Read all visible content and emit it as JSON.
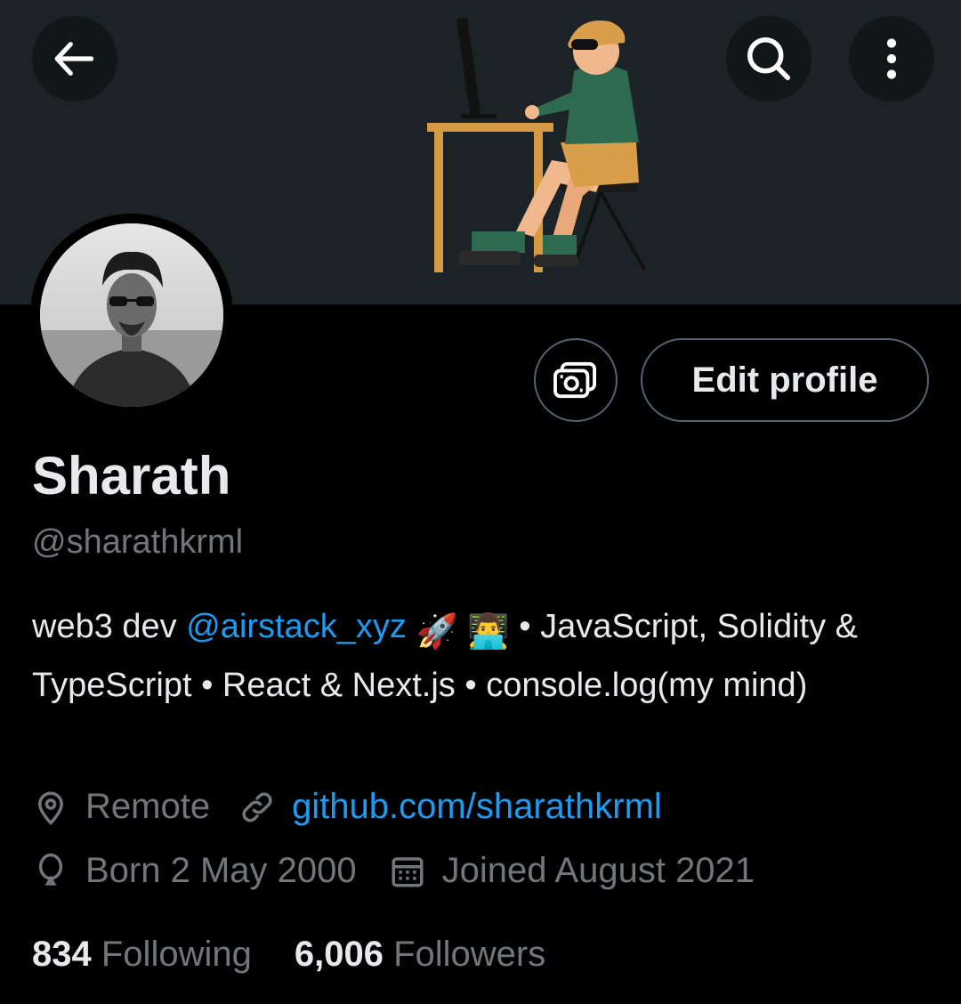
{
  "header": {
    "back_icon": "arrow-left-icon",
    "search_icon": "search-icon",
    "more_icon": "more-vertical-icon"
  },
  "profile": {
    "display_name": "Sharath",
    "handle": "@sharathkrml",
    "edit_label": "Edit profile",
    "bio": {
      "part1": "web3 dev ",
      "mention": "@airstack_xyz",
      "emoji1": "🚀",
      "emoji2": "👨‍💻",
      "part2": " • JavaScript, Solidity & TypeScript  • React & Next.js • console.log(my mind)"
    },
    "location": "Remote",
    "website": "github.com/sharathkrml",
    "birthday": "Born 2 May 2000",
    "joined": "Joined August 2021",
    "following_count": "834",
    "following_label": "Following",
    "followers_count": "6,006",
    "followers_label": "Followers"
  },
  "colors": {
    "background": "#000000",
    "banner": "#1c2326",
    "text": "#e7e9ea",
    "muted": "#71767b",
    "link": "#1d9bf0",
    "border": "#536471"
  }
}
